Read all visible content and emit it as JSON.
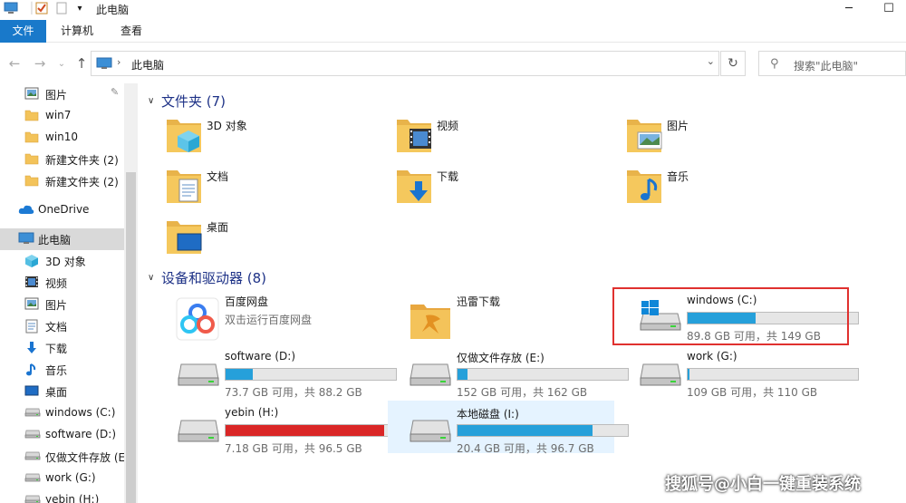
{
  "window": {
    "title": "此电脑",
    "minimize_glyph": "─",
    "maximize_glyph": "☐"
  },
  "ribbon": {
    "tabs": [
      {
        "label": "文件",
        "active": true
      },
      {
        "label": "计算机",
        "active": false
      },
      {
        "label": "查看",
        "active": false
      }
    ]
  },
  "address": {
    "path": "此电脑",
    "search_placeholder": "搜索\"此电脑\""
  },
  "sidebar": {
    "items": [
      {
        "label": "图片",
        "icon": "pictures-icon",
        "pinned": true
      },
      {
        "label": "win7",
        "icon": "folder-icon"
      },
      {
        "label": "win10",
        "icon": "folder-icon"
      },
      {
        "label": "新建文件夹 (2)",
        "icon": "folder-icon"
      },
      {
        "label": "新建文件夹 (2)",
        "icon": "folder-icon"
      },
      {
        "label": "OneDrive",
        "icon": "cloud-icon"
      },
      {
        "label": "此电脑",
        "icon": "computer-icon",
        "selected": true
      },
      {
        "label": "3D 对象",
        "icon": "3d-objects-icon"
      },
      {
        "label": "视频",
        "icon": "video-icon"
      },
      {
        "label": "图片",
        "icon": "pictures-icon"
      },
      {
        "label": "文档",
        "icon": "documents-icon"
      },
      {
        "label": "下载",
        "icon": "download-icon"
      },
      {
        "label": "音乐",
        "icon": "music-icon"
      },
      {
        "label": "桌面",
        "icon": "desktop-icon"
      },
      {
        "label": "windows (C:)",
        "icon": "drive-icon"
      },
      {
        "label": "software (D:)",
        "icon": "drive-icon"
      },
      {
        "label": "仅做文件存放 (E",
        "icon": "drive-icon"
      },
      {
        "label": "work (G:)",
        "icon": "drive-icon"
      },
      {
        "label": "yebin (H:)",
        "icon": "drive-icon"
      }
    ]
  },
  "folders_section": {
    "title": "文件夹 (7)",
    "items": [
      {
        "label": "3D 对象",
        "icon": "3d-objects-folder-icon"
      },
      {
        "label": "视频",
        "icon": "video-folder-icon"
      },
      {
        "label": "图片",
        "icon": "pictures-folder-icon"
      },
      {
        "label": "文档",
        "icon": "documents-folder-icon"
      },
      {
        "label": "下载",
        "icon": "download-folder-icon"
      },
      {
        "label": "音乐",
        "icon": "music-folder-icon"
      },
      {
        "label": "桌面",
        "icon": "desktop-folder-icon"
      }
    ]
  },
  "devices_section": {
    "title": "设备和驱动器 (8)",
    "items": [
      {
        "name": "百度网盘",
        "subtitle": "双击运行百度网盘",
        "icon": "baidu-netdisk-icon"
      },
      {
        "name": "迅雷下载",
        "icon": "thunder-folder-icon"
      },
      {
        "name": "windows (C:)",
        "status": "89.8 GB 可用，共 149 GB",
        "used_fraction": 0.4,
        "icon": "windows-drive-icon"
      },
      {
        "name": "software (D:)",
        "status": "73.7 GB 可用，共 88.2 GB",
        "used_fraction": 0.16,
        "icon": "drive-icon"
      },
      {
        "name": "仅做文件存放 (E:)",
        "status": "152 GB 可用，共 162 GB",
        "used_fraction": 0.06,
        "icon": "drive-icon"
      },
      {
        "name": "work (G:)",
        "status": "109 GB 可用，共 110 GB",
        "used_fraction": 0.01,
        "icon": "drive-icon"
      },
      {
        "name": "yebin (H:)",
        "status": "7.18 GB 可用，共 96.5 GB",
        "used_fraction": 0.93,
        "icon": "drive-icon",
        "critical": true
      },
      {
        "name": "本地磁盘 (I:)",
        "status": "20.4 GB 可用，共 96.7 GB",
        "used_fraction": 0.79,
        "icon": "drive-icon",
        "highlighted": true
      }
    ]
  },
  "watermark": "搜狐号@小白一键重装系统",
  "colors": {
    "accent": "#1979ca",
    "bar_normal": "#26a0da",
    "bar_critical": "#da2626",
    "section_title": "#1e3287",
    "annotation_box": "#e0312f"
  }
}
